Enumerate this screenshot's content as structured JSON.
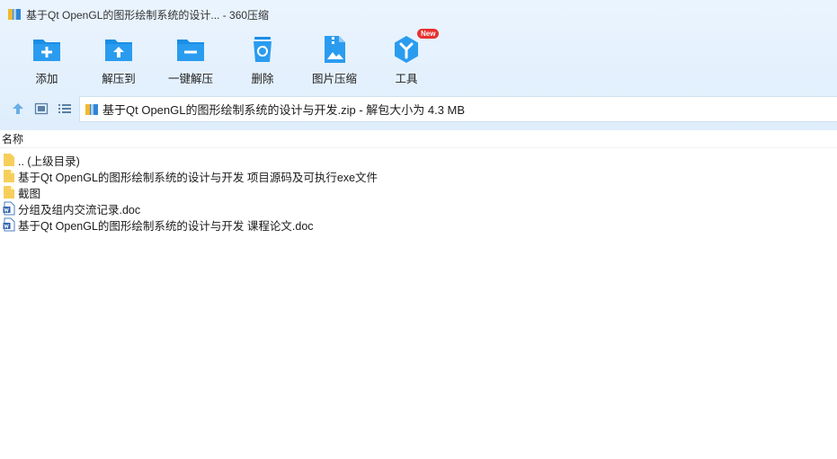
{
  "window": {
    "title": "基于Qt OpenGL的图形绘制系统的设计... - 360压缩"
  },
  "toolbar": {
    "items": [
      {
        "label": "添加",
        "icon": "folder-add-icon"
      },
      {
        "label": "解压到",
        "icon": "folder-extract-icon"
      },
      {
        "label": "一键解压",
        "icon": "folder-oneclick-icon"
      },
      {
        "label": "删除",
        "icon": "trash-icon"
      },
      {
        "label": "图片压缩",
        "icon": "image-compress-icon"
      },
      {
        "label": "工具",
        "icon": "tools-icon",
        "badge": "New"
      }
    ]
  },
  "address": {
    "path": "基于Qt OpenGL的图形绘制系统的设计与开发.zip - 解包大小为 4.3 MB"
  },
  "filelist": {
    "column_name": "名称",
    "items": [
      {
        "name": ".. (上级目录)",
        "type": "folder"
      },
      {
        "name": "基于Qt OpenGL的图形绘制系统的设计与开发 项目源码及可执行exe文件",
        "type": "folder"
      },
      {
        "name": "截图",
        "type": "folder"
      },
      {
        "name": "分组及组内交流记录.doc",
        "type": "doc"
      },
      {
        "name": "基于Qt OpenGL的图形绘制系统的设计与开发 课程论文.doc",
        "type": "doc"
      }
    ]
  },
  "colors": {
    "accent": "#1a8ee6",
    "folder": "#f6cf5b",
    "badge": "#e8312f"
  }
}
